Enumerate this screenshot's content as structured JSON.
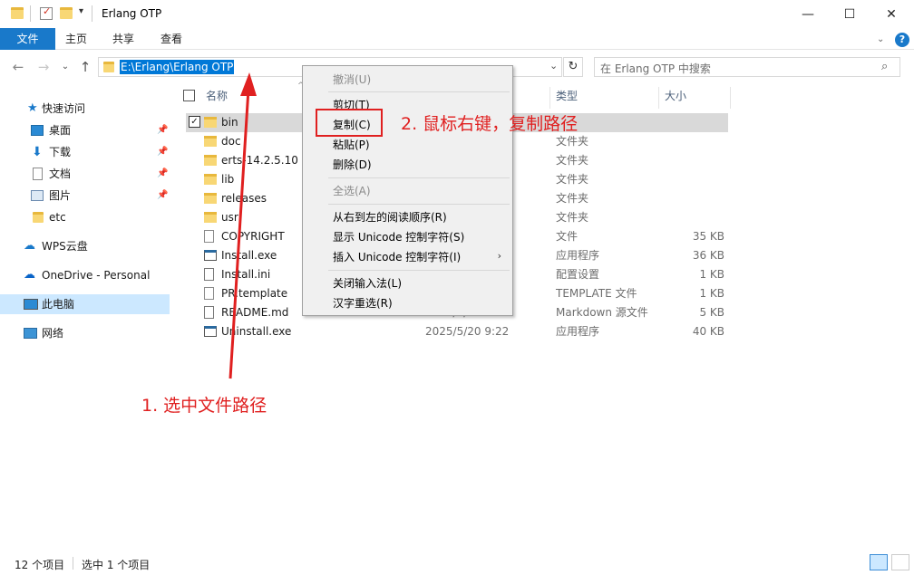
{
  "window": {
    "title": "Erlang OTP",
    "minimize": "—",
    "maximize": "☐",
    "close": "✕"
  },
  "ribbon": {
    "tabs": [
      "文件",
      "主页",
      "共享",
      "查看"
    ],
    "help": "?"
  },
  "address": {
    "path": "E:\\Erlang\\Erlang OTP",
    "search_placeholder": "在 Erlang OTP 中搜索"
  },
  "nav_pane": {
    "quick_access": "快速访问",
    "items": [
      "桌面",
      "下载",
      "文档",
      "图片",
      "etc"
    ],
    "wps": "WPS云盘",
    "onedrive": "OneDrive - Personal",
    "this_pc": "此电脑",
    "network": "网络"
  },
  "columns": {
    "name": "名称",
    "type": "类型",
    "size": "大小"
  },
  "files": [
    {
      "name": "bin",
      "date": "",
      "type": "",
      "size": "",
      "icon": "folder",
      "selected": true
    },
    {
      "name": "doc",
      "date": "",
      "type": "文件夹",
      "size": "",
      "icon": "folder"
    },
    {
      "name": "erts-14.2.5.10",
      "date": "",
      "type": "文件夹",
      "size": "",
      "icon": "folder"
    },
    {
      "name": "lib",
      "date": "",
      "type": "文件夹",
      "size": "",
      "icon": "folder"
    },
    {
      "name": "releases",
      "date": "",
      "type": "文件夹",
      "size": "",
      "icon": "folder"
    },
    {
      "name": "usr",
      "date": "",
      "type": "文件夹",
      "size": "",
      "icon": "folder"
    },
    {
      "name": "COPYRIGHT",
      "date": "",
      "type": "文件",
      "size": "35 KB",
      "icon": "file"
    },
    {
      "name": "Install.exe",
      "date": "",
      "type": "应用程序",
      "size": "36 KB",
      "icon": "exe"
    },
    {
      "name": "Install.ini",
      "date": "",
      "type": "配置设置",
      "size": "1 KB",
      "icon": "ini"
    },
    {
      "name": "PR.template",
      "date": "",
      "type": "TEMPLATE 文件",
      "size": "1 KB",
      "icon": "file"
    },
    {
      "name": "README.md",
      "date": "2025/5/",
      "type": "Markdown 源文件",
      "size": "5 KB",
      "icon": "md"
    },
    {
      "name": "Uninstall.exe",
      "date": "2025/5/20 9:22",
      "type": "应用程序",
      "size": "40 KB",
      "icon": "exe"
    }
  ],
  "context_menu": {
    "undo": "撤消(U)",
    "cut": "剪切(T)",
    "copy": "复制(C)",
    "paste": "粘贴(P)",
    "delete": "删除(D)",
    "select_all": "全选(A)",
    "rtl": "从右到左的阅读顺序(R)",
    "show_unicode": "显示 Unicode 控制字符(S)",
    "insert_unicode": "插入 Unicode 控制字符(I)",
    "close_ime": "关闭输入法(L)",
    "reconvert": "汉字重选(R)"
  },
  "annotations": {
    "step1": "1. 选中文件路径",
    "step2": "2. 鼠标右键，复制路径",
    "color": "#e02020"
  },
  "status": {
    "count": "12 个项目",
    "selected": "选中 1 个项目"
  }
}
